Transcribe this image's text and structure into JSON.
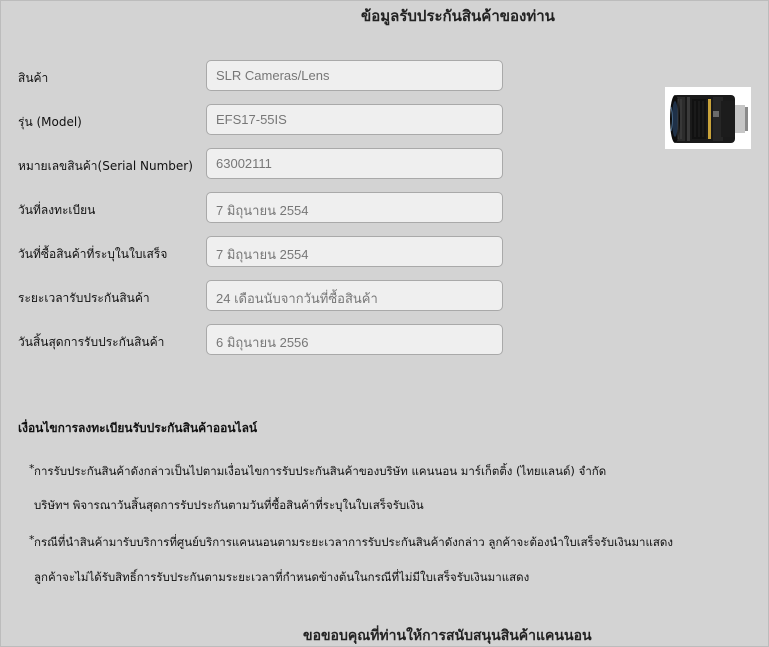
{
  "page": {
    "title": "ข้อมูลรับประกันสินค้าของท่าน",
    "footer": "ขอขอบคุณที่ท่านให้การสนับสนุนสินค้าแคนนอน"
  },
  "form": {
    "fields": [
      {
        "label": "สินค้า",
        "value": "SLR Cameras/Lens"
      },
      {
        "label": "รุ่น (Model)",
        "value": "EFS17-55IS"
      },
      {
        "label": "หมายเลขสินค้า(Serial Number)",
        "value": "63002111"
      },
      {
        "label": "วันที่ลงทะเบียน",
        "value": "7 มิถุนายน 2554"
      },
      {
        "label": "วันที่ซื้อสินค้าที่ระบุในใบเสร็จ",
        "value": "7 มิถุนายน 2554"
      },
      {
        "label": "ระยะเวลารับประกันสินค้า",
        "value": "24 เดือนนับจากวันที่ซื้อสินค้า"
      },
      {
        "label": "วันสิ้นสุดการรับประกันสินค้า",
        "value": "6 มิถุนายน 2556"
      }
    ]
  },
  "product_image": {
    "icon": "camera-lens-image"
  },
  "terms": {
    "title": "เงื่อนไขการลงทะเบียนรับประกันสินค้าออนไลน์",
    "bullet": "*",
    "items": [
      {
        "line1": "การรับประกันสินค้าดังกล่าวเป็นไปตามเงื่อนไขการรับประกันสินค้าของบริษัท แคนนอน มาร์เก็ตติ้ง (ไทยแลนด์) จำกัด",
        "line2": "บริษัทฯ พิจารณาวันสิ้นสุดการรับประกันตามวันที่ซื้อสินค้าที่ระบุในใบเสร็จรับเงิน"
      },
      {
        "line1": "กรณีที่นำสินค้ามารับบริการที่ศูนย์บริการแคนนอนตามระยะเวลาการรับประกันสินค้าดังกล่าว ลูกค้าจะต้องนำใบเสร็จรับเงินมาแสดง",
        "line2": "ลูกค้าจะไม่ได้รับสิทธิ์การรับประกันตามระยะเวลาที่กำหนดข้างต้นในกรณีที่ไม่มีใบเสร็จรับเงินมาแสดง"
      }
    ]
  }
}
